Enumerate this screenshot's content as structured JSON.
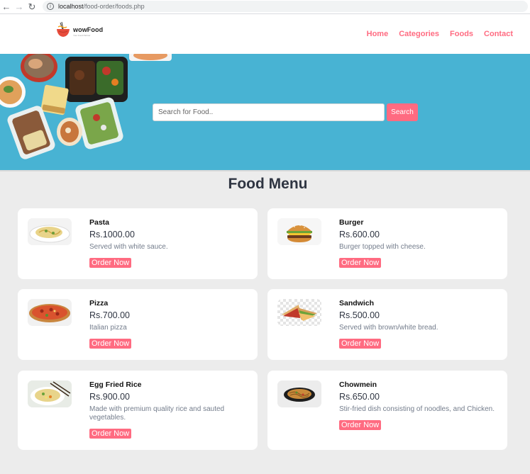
{
  "browser": {
    "url_host": "localhost",
    "url_path": "/food-order/foods.php"
  },
  "header": {
    "logo_name": "wowFood",
    "logo_tagline": "Your Food Partner",
    "nav": [
      "Home",
      "Categories",
      "Foods",
      "Contact"
    ]
  },
  "hero": {
    "search_placeholder": "Search for Food..",
    "search_button": "Search"
  },
  "menu": {
    "title": "Food Menu",
    "order_label": "Order Now",
    "items": [
      {
        "name": "Pasta",
        "price": "Rs.1000.00",
        "desc": "Served with white sauce."
      },
      {
        "name": "Burger",
        "price": "Rs.600.00",
        "desc": "Burger topped with cheese."
      },
      {
        "name": "Pizza",
        "price": "Rs.700.00",
        "desc": "Italian pizza"
      },
      {
        "name": "Sandwich",
        "price": "Rs.500.00",
        "desc": "Served with brown/white bread."
      },
      {
        "name": "Egg Fried Rice",
        "price": "Rs.900.00",
        "desc": "Made with premium quality rice and sauted vegetables."
      },
      {
        "name": "Chowmein",
        "price": "Rs.650.00",
        "desc": "Stir-fried dish consisting of noodles, and Chicken."
      }
    ]
  },
  "colors": {
    "accent": "#ff6b81",
    "hero_bg": "#48b3d3",
    "page_bg": "#ececec",
    "title": "#2f3542",
    "desc": "#747d8c"
  }
}
